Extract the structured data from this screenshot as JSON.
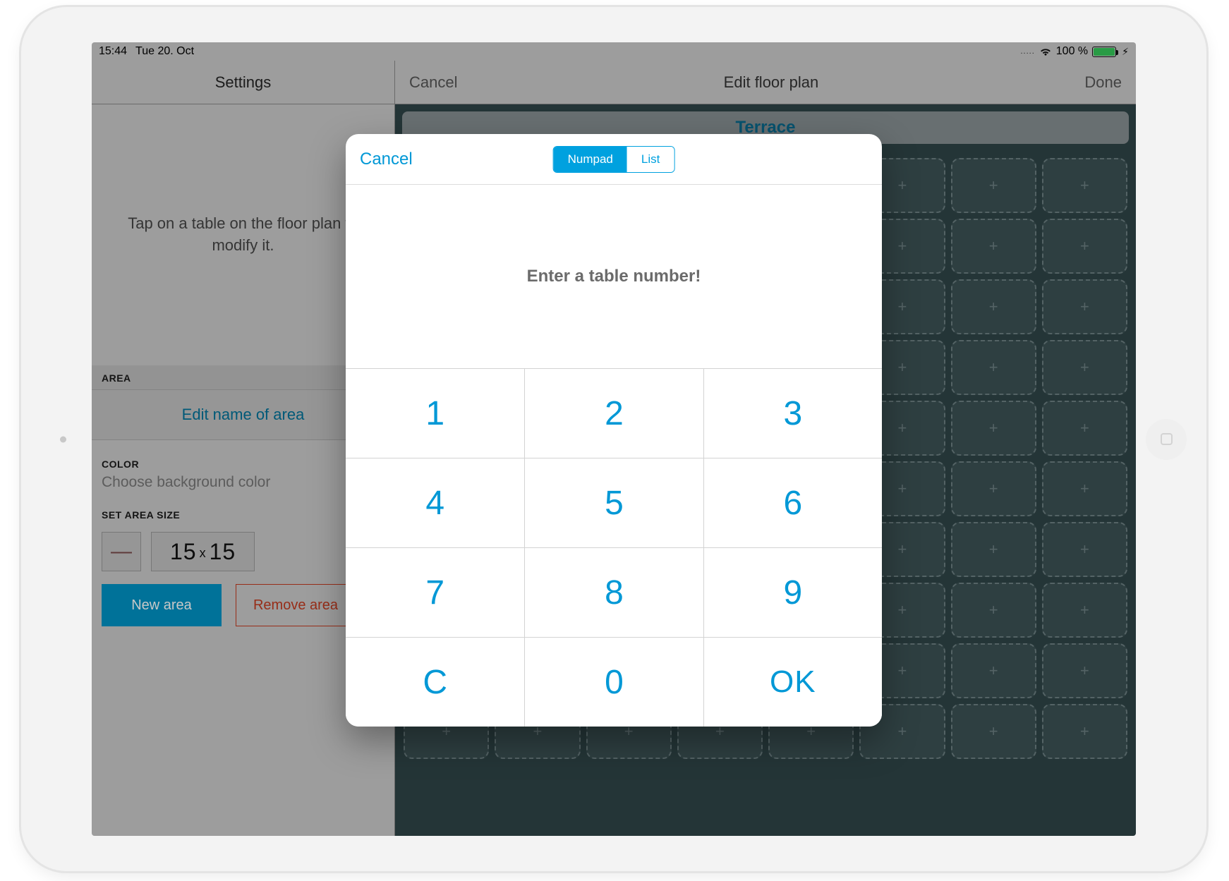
{
  "statusbar": {
    "time": "15:44",
    "date": "Tue 20. Oct",
    "battery_pct": "100 %",
    "dots": "....."
  },
  "header": {
    "settings": "Settings",
    "cancel": "Cancel",
    "title": "Edit floor plan",
    "done": "Done"
  },
  "sidebar": {
    "instruction": "Tap on a table on the floor plan to modify it.",
    "area_label": "AREA",
    "edit_name": "Edit name of area",
    "color_label": "COLOR",
    "color_desc": "Choose background color",
    "size_label": "SET AREA SIZE",
    "size_w": "15",
    "size_h": "15",
    "new_area": "New area",
    "remove_area": "Remove area",
    "minus": "—",
    "x": "x"
  },
  "floor": {
    "tab": "Terrace",
    "cell_glyph": "+"
  },
  "modal": {
    "cancel": "Cancel",
    "seg_numpad": "Numpad",
    "seg_list": "List",
    "prompt": "Enter a table number!",
    "keys": {
      "k1": "1",
      "k2": "2",
      "k3": "3",
      "k4": "4",
      "k5": "5",
      "k6": "6",
      "k7": "7",
      "k8": "8",
      "k9": "9",
      "kc": "C",
      "k0": "0",
      "kok": "OK"
    }
  }
}
